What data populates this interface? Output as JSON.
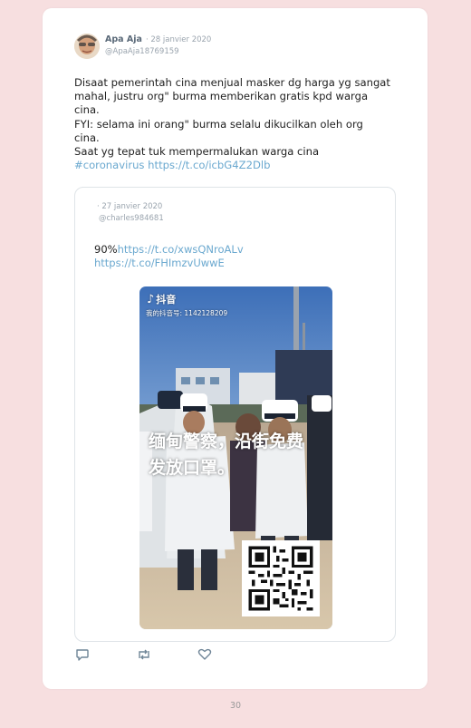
{
  "tweet": {
    "author_name": "Apa Aja",
    "date": "· 28 janvier 2020",
    "handle": "@ApaAja18769159",
    "text_lines": [
      "Disaat pemerintah cina menjual masker dg harga yg sangat",
      "mahal, justru org\" burma memberikan gratis kpd warga",
      "cina.",
      "FYI: selama ini orang\" burma selalu dikucilkan oleh org",
      "cina.",
      "Saat yg tepat tuk mempermalukan warga cina"
    ],
    "hashtag": "#coronavirus",
    "link": "https://t.co/icbG4Z2Dlb"
  },
  "quoted_tweet": {
    "date": "· 27 janvier 2020",
    "handle": "@charles984681",
    "text_prefix": "90%",
    "link1": "https://t.co/xwsQNroALv",
    "link2": "https://t.co/FHImzvUwwE"
  },
  "video": {
    "app_name": "抖音",
    "app_id": "我的抖音号: 1142128209",
    "caption_line1": "缅甸警察，沿街免费",
    "caption_line2": "发放口罩。"
  },
  "actions": {
    "reply_icon": "reply-icon",
    "retweet_icon": "retweet-icon",
    "like_icon": "heart-icon"
  },
  "page_number": "30",
  "colors": {
    "page_background": "#f7dfe0",
    "link": "#6aa8cf",
    "author_name": "#5a6978",
    "muted": "#9aa4ae"
  }
}
